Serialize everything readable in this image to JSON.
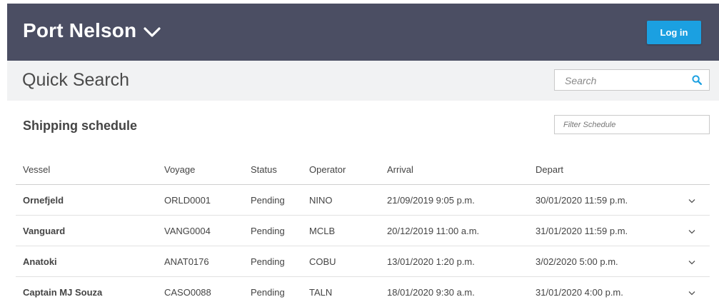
{
  "header": {
    "site_title": "Port Nelson",
    "login_label": "Log in",
    "bg_color": "#4b4e63",
    "login_color": "#1ba0e1"
  },
  "quick_search": {
    "title": "Quick Search",
    "search_placeholder": "Search"
  },
  "schedule": {
    "title": "Shipping schedule",
    "filter_placeholder": "Filter Schedule",
    "columns": [
      "Vessel",
      "Voyage",
      "Status",
      "Operator",
      "Arrival",
      "Depart"
    ],
    "rows": [
      {
        "vessel": "Ornefjeld",
        "voyage": "ORLD0001",
        "status": "Pending",
        "operator": "NINO",
        "arrival": "21/09/2019 9:05 p.m.",
        "depart": "30/01/2020 11:59 p.m."
      },
      {
        "vessel": "Vanguard",
        "voyage": "VANG0004",
        "status": "Pending",
        "operator": "MCLB",
        "arrival": "20/12/2019 11:00 a.m.",
        "depart": "31/01/2020 11:59 p.m."
      },
      {
        "vessel": "Anatoki",
        "voyage": "ANAT0176",
        "status": "Pending",
        "operator": "COBU",
        "arrival": "13/01/2020 1:20 p.m.",
        "depart": "3/02/2020 5:00 p.m."
      },
      {
        "vessel": "Captain MJ Souza",
        "voyage": "CASO0088",
        "status": "Pending",
        "operator": "TALN",
        "arrival": "18/01/2020 9:30 a.m.",
        "depart": "31/01/2020 4:00 p.m."
      }
    ]
  },
  "icons": {
    "site_menu": "chevron-down-icon",
    "search": "search-icon",
    "row_expand": "chevron-down-icon"
  }
}
